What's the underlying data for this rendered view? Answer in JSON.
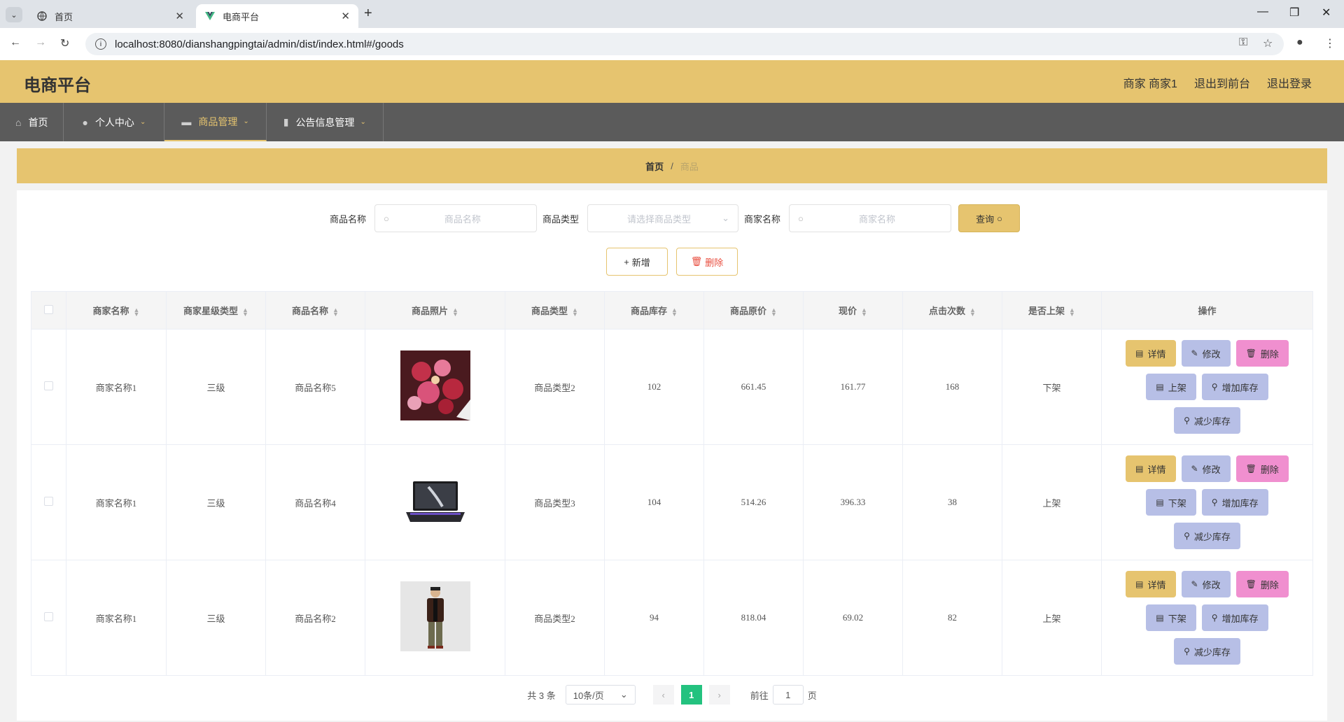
{
  "browser": {
    "tabs": [
      {
        "title": "首页",
        "active": false
      },
      {
        "title": "电商平台",
        "active": true
      }
    ],
    "url": "localhost:8080/dianshangpingtai/admin/dist/index.html#/goods"
  },
  "header": {
    "logo": "电商平台",
    "user": "商家 商家1",
    "to_front": "退出到前台",
    "logout": "退出登录"
  },
  "menu": [
    {
      "label": "首页",
      "icon": "home-icon"
    },
    {
      "label": "个人中心",
      "icon": "user-icon"
    },
    {
      "label": "商品管理",
      "icon": "goods-icon"
    },
    {
      "label": "公告信息管理",
      "icon": "chart-icon"
    }
  ],
  "breadcrumb": {
    "home": "首页",
    "sep": "/",
    "current": "商品"
  },
  "search": {
    "name_label": "商品名称",
    "name_placeholder": "商品名称",
    "type_label": "商品类型",
    "type_placeholder": "请选择商品类型",
    "merchant_label": "商家名称",
    "merchant_placeholder": "商家名称",
    "query": "查询"
  },
  "actions": {
    "add": "新增",
    "delete": "删除"
  },
  "table": {
    "headers": [
      "商家名称",
      "商家星级类型",
      "商品名称",
      "商品照片",
      "商品类型",
      "商品库存",
      "商品原价",
      "现价",
      "点击次数",
      "是否上架",
      "操作"
    ],
    "rows": [
      {
        "merchant": "商家名称1",
        "level": "三级",
        "name": "商品名称5",
        "photo": "flower-bouquet",
        "type": "商品类型2",
        "stock": "102",
        "orig": "661.45",
        "price": "161.77",
        "clicks": "168",
        "onsale": "下架",
        "toggle": "上架"
      },
      {
        "merchant": "商家名称1",
        "level": "三级",
        "name": "商品名称4",
        "photo": "laptop",
        "type": "商品类型3",
        "stock": "104",
        "orig": "514.26",
        "price": "396.33",
        "clicks": "38",
        "onsale": "上架",
        "toggle": "下架"
      },
      {
        "merchant": "商家名称1",
        "level": "三级",
        "name": "商品名称2",
        "photo": "man-in-jacket",
        "type": "商品类型2",
        "stock": "94",
        "orig": "818.04",
        "price": "69.02",
        "clicks": "82",
        "onsale": "上架",
        "toggle": "下架"
      }
    ],
    "op_labels": {
      "detail": "详情",
      "edit": "修改",
      "delete": "删除",
      "add_stock": "增加库存",
      "reduce_stock": "减少库存"
    }
  },
  "pagination": {
    "total": "共 3 条",
    "page_size": "10条/页",
    "current": "1",
    "goto": "前往",
    "goto_value": "1",
    "page_unit": "页"
  },
  "colors": {
    "accent": "#e6c46f",
    "menu_bg": "#5b5b5b",
    "pager_active": "#23c27f",
    "btn_lavender": "#b7bfe6",
    "btn_pink": "#f08fcf"
  }
}
